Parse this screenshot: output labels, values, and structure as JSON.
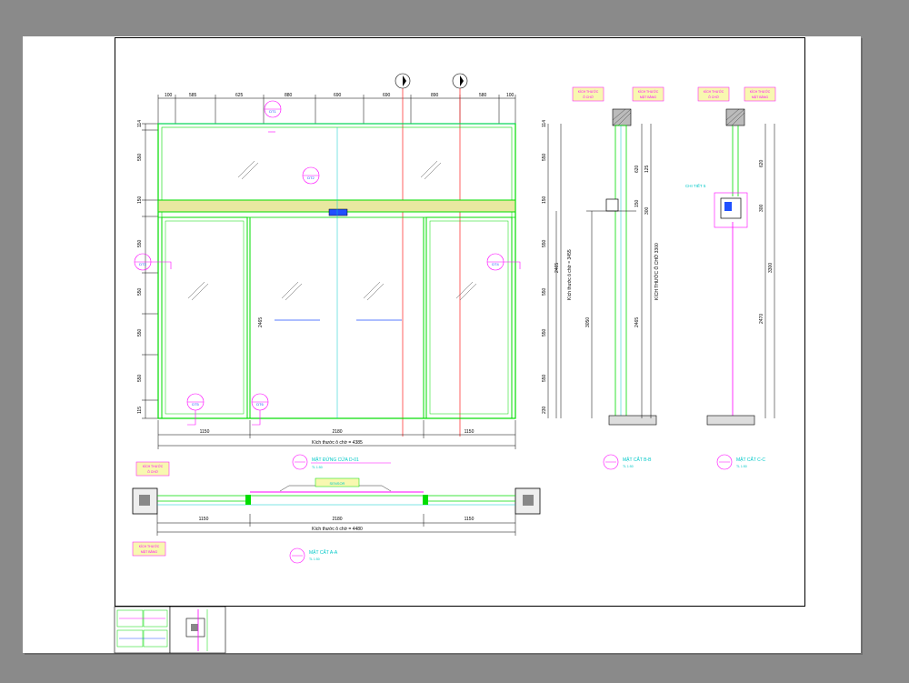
{
  "elevation": {
    "top_dims": [
      "100",
      "585",
      "625",
      "880",
      "690",
      "690",
      "890",
      "580",
      "100"
    ],
    "left_dims": [
      "114",
      "550",
      "150",
      "550",
      "550",
      "550",
      "550",
      "115"
    ],
    "right_dims": [
      "114",
      "550",
      "150",
      "550",
      "550",
      "550",
      "550",
      "230"
    ],
    "inner_height": "2465",
    "bottom_dims": [
      "1150",
      "2180",
      "1150"
    ],
    "total_width": "Kích thước ô chờ = 4385",
    "vertical_total": "Kích thước ô chờ = 3455",
    "callouts": [
      "DT1",
      "DT2",
      "DT3",
      "DT4",
      "DT5",
      "DT6"
    ],
    "title": "MẶT ĐỨNG CỬA D-01",
    "title_sub": "TL 1:50"
  },
  "section_b": {
    "tag1_top": "KÍCH THƯỚC",
    "tag1_bot": "Ô CHỜ",
    "tag2_top": "KÍCH THƯỚC",
    "tag2_bot": "MẶT BẰNG",
    "dims_a": [
      "620",
      "150",
      "2465"
    ],
    "dims_b": [
      "125",
      "300",
      "2465"
    ],
    "total": "KÍCH THƯỚC Ô CHỜ 3300",
    "base_dim": "3050",
    "title": "MẶT CẮT B-B",
    "title_sub": "TL 1:50"
  },
  "section_c": {
    "tag1_top": "KÍCH THƯỚC",
    "tag1_bot": "Ô CHỜ",
    "tag2_top": "KÍCH THƯỚC",
    "tag2_bot": "MẶT BẰNG",
    "detail_label": "CHI TIẾT 5",
    "dims": [
      "620",
      "300",
      "2470"
    ],
    "total": "3300",
    "title": "MẶT CẮT C-C",
    "title_sub": "TL 1:50"
  },
  "plan": {
    "tag_top": "KÍCH THƯỚC",
    "tag_bot": "Ô CHỜ",
    "tag2_top": "KÍCH THƯỚC",
    "tag2_bot": "MẶT BẰNG",
    "sensor_label": "SENSOR",
    "dims": [
      "1150",
      "2180",
      "1150"
    ],
    "total": "Kích thước ô chờ = 4480",
    "title": "MẶT CẮT A-A",
    "title_sub": "TL 1:50"
  },
  "colors": {
    "frame_green": "#00dd00",
    "red_line": "#ff2020",
    "magenta": "#ff00ff",
    "cyan": "#00c8c8",
    "yellow_band": "#e8e8a0"
  }
}
